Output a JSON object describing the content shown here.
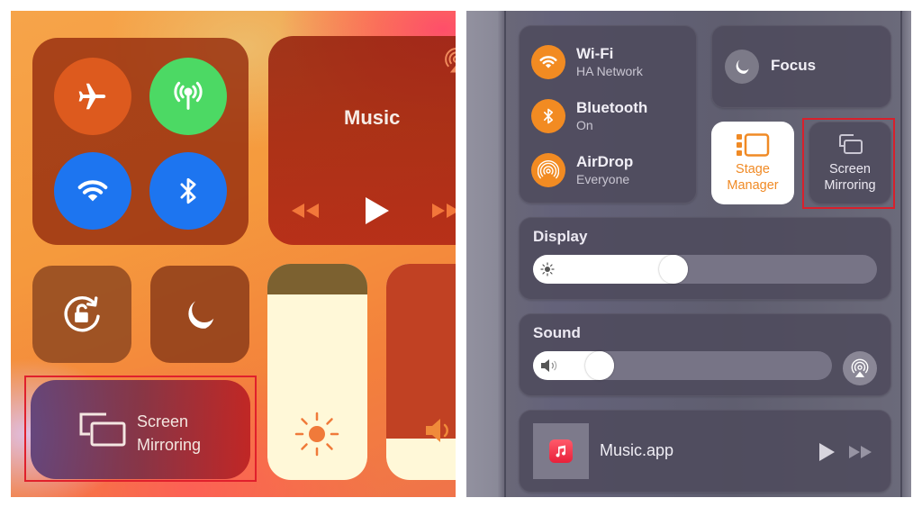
{
  "ios": {
    "connectivity": {
      "airplane": {
        "icon": "airplane-icon",
        "on": false
      },
      "cellular": {
        "icon": "cellular-antenna-icon",
        "on": true,
        "color": "#4cd964"
      },
      "wifi": {
        "icon": "wifi-icon",
        "on": true,
        "color": "#1d75f0"
      },
      "bluetooth": {
        "icon": "bluetooth-icon",
        "on": true,
        "color": "#1d75f0"
      }
    },
    "music": {
      "title": "Music",
      "controls": [
        "rewind-icon",
        "play-icon",
        "fast-forward-icon"
      ],
      "airplay_icon": "airplay-audio-icon"
    },
    "rotation_lock": {
      "icon": "rotation-lock-icon"
    },
    "do_not_disturb": {
      "icon": "moon-icon"
    },
    "screen_mirroring": {
      "line1": "Screen",
      "line2": "Mirroring",
      "icon": "screen-mirroring-icon",
      "highlighted": true
    },
    "brightness": {
      "icon": "sun-icon",
      "level_percent": 86
    },
    "volume": {
      "icon": "speaker-icon",
      "level_percent": 19
    }
  },
  "mac": {
    "connectivity": [
      {
        "title": "Wi-Fi",
        "subtitle": "HA Network",
        "icon": "wifi-icon"
      },
      {
        "title": "Bluetooth",
        "subtitle": "On",
        "icon": "bluetooth-icon"
      },
      {
        "title": "AirDrop",
        "subtitle": "Everyone",
        "icon": "airdrop-icon"
      }
    ],
    "focus": {
      "label": "Focus",
      "icon": "moon-icon"
    },
    "stage_manager": {
      "line1": "Stage",
      "line2": "Manager",
      "icon": "stage-manager-icon",
      "active": true
    },
    "screen_mirroring": {
      "line1": "Screen",
      "line2": "Mirroring",
      "icon": "screen-mirroring-icon",
      "highlighted": true
    },
    "display": {
      "title": "Display",
      "brightness_percent": 45,
      "icon": "sun-icon"
    },
    "sound": {
      "title": "Sound",
      "volume_percent": 27,
      "icon": "speaker-icon",
      "output_icon": "airplay-audio-icon"
    },
    "now_playing": {
      "track": "Music.app",
      "icon": "music-app-icon",
      "controls": [
        "play-icon",
        "fast-forward-icon"
      ]
    },
    "accent_color": "#f28b22",
    "highlight_color": "#d8202c"
  }
}
